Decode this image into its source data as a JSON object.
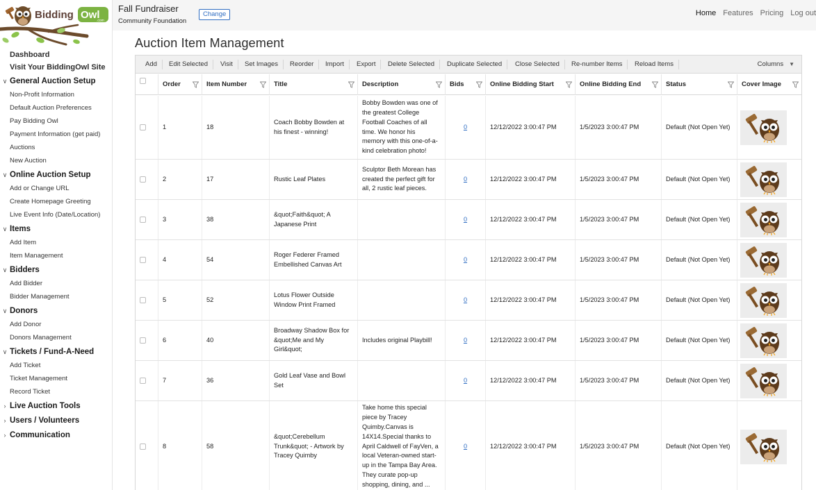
{
  "brand": {
    "logo_text_1": "Bidding",
    "logo_text_2": "Owl",
    "logo_sub": ".com"
  },
  "sidebar": {
    "top_links": [
      "Dashboard",
      "Visit Your BiddingOwl Site"
    ],
    "sections": [
      {
        "title": "General Auction Setup",
        "expanded": true,
        "items": [
          "Non-Profit Information",
          "Default Auction Preferences",
          "Pay Bidding Owl",
          "Payment Information (get paid)",
          "Auctions",
          "New Auction"
        ]
      },
      {
        "title": "Online Auction Setup",
        "expanded": true,
        "items": [
          "Add or Change URL",
          "Create Homepage Greeting",
          "Live Event Info (Date/Location)"
        ]
      },
      {
        "title": "Items",
        "expanded": true,
        "items": [
          "Add Item",
          "Item Management"
        ]
      },
      {
        "title": "Bidders",
        "expanded": true,
        "items": [
          "Add Bidder",
          "Bidder Management"
        ]
      },
      {
        "title": "Donors",
        "expanded": true,
        "items": [
          "Add Donor",
          "Donors Management"
        ]
      },
      {
        "title": "Tickets / Fund-A-Need",
        "expanded": true,
        "items": [
          "Add Ticket",
          "Ticket Management",
          "Record Ticket"
        ]
      },
      {
        "title": "Live Auction Tools",
        "expanded": false,
        "items": []
      },
      {
        "title": "Users / Volunteers",
        "expanded": false,
        "items": []
      },
      {
        "title": "Communication",
        "expanded": false,
        "items": []
      }
    ]
  },
  "header": {
    "event_title": "Fall Fundraiser",
    "event_org": "Community Foundation",
    "change_label": "Change",
    "nav": [
      "Home",
      "Features",
      "Pricing",
      "Log out"
    ],
    "active_nav": "Home"
  },
  "page_title": "Auction Item Management",
  "toolbar": {
    "buttons": [
      "Add",
      "Edit Selected",
      "Visit",
      "Set Images",
      "Reorder",
      "Import",
      "Export",
      "Delete Selected",
      "Duplicate Selected",
      "Close Selected",
      "Re-number Items",
      "Reload Items"
    ],
    "columns_label": "Columns"
  },
  "table": {
    "columns": [
      "Order",
      "Item Number",
      "Title",
      "Description",
      "Bids",
      "Online Bidding Start",
      "Online Bidding End",
      "Status",
      "Cover Image"
    ],
    "rows": [
      {
        "order": "1",
        "item_number": "18",
        "title": "Coach Bobby Bowden at his finest - winning!",
        "description": "Bobby Bowden was one of the greatest College Football Coaches of all time. We honor his memory with this one-of-a-kind celebration photo!",
        "bids": "0",
        "start": "12/12/2022 3:00:47 PM",
        "end": "1/5/2023 3:00:47 PM",
        "status": "Default (Not Open Yet)"
      },
      {
        "order": "2",
        "item_number": "17",
        "title": "Rustic Leaf Plates",
        "description": "Sculptor Beth Morean has created the perfect gift for all, 2 rustic leaf pieces.",
        "bids": "0",
        "start": "12/12/2022 3:00:47 PM",
        "end": "1/5/2023 3:00:47 PM",
        "status": "Default (Not Open Yet)"
      },
      {
        "order": "3",
        "item_number": "38",
        "title": "&quot;Faith&quot; A Japanese Print",
        "description": "",
        "bids": "0",
        "start": "12/12/2022 3:00:47 PM",
        "end": "1/5/2023 3:00:47 PM",
        "status": "Default (Not Open Yet)"
      },
      {
        "order": "4",
        "item_number": "54",
        "title": "Roger Federer Framed Embellished Canvas Art",
        "description": "",
        "bids": "0",
        "start": "12/12/2022 3:00:47 PM",
        "end": "1/5/2023 3:00:47 PM",
        "status": "Default (Not Open Yet)"
      },
      {
        "order": "5",
        "item_number": "52",
        "title": "Lotus Flower Outside Window Print Framed",
        "description": "",
        "bids": "0",
        "start": "12/12/2022 3:00:47 PM",
        "end": "1/5/2023 3:00:47 PM",
        "status": "Default (Not Open Yet)"
      },
      {
        "order": "6",
        "item_number": "40",
        "title": "Broadway Shadow Box for &quot;Me and My Girl&quot;",
        "description": "Includes original Playbill!",
        "bids": "0",
        "start": "12/12/2022 3:00:47 PM",
        "end": "1/5/2023 3:00:47 PM",
        "status": "Default (Not Open Yet)"
      },
      {
        "order": "7",
        "item_number": "36",
        "title": "Gold Leaf Vase and Bowl Set",
        "description": "",
        "bids": "0",
        "start": "12/12/2022 3:00:47 PM",
        "end": "1/5/2023 3:00:47 PM",
        "status": "Default (Not Open Yet)"
      },
      {
        "order": "8",
        "item_number": "58",
        "title": "&quot;Cerebellum Trunk&quot; - Artwork by Tracey Quimby",
        "description": "Take home this special piece by Tracey Quimby.Canvas is 14X14.Special thanks to April Caldwell of FayVen, a local Veteran-owned start-up in the Tampa Bay Area. They curate pop-up shopping, dining, and ...",
        "bids": "0",
        "start": "12/12/2022 3:00:47 PM",
        "end": "1/5/2023 3:00:47 PM",
        "status": "Default (Not Open Yet)"
      }
    ]
  },
  "colors": {
    "link_blue": "#2f6dc2",
    "brand_green": "#7cb342",
    "brand_brown": "#6d4c2a",
    "header_bg": "#f5f5f5",
    "toolbar_bg": "#f0f0f0"
  },
  "icons": {
    "cover_image": "owl-gavel-icon",
    "filter": "filter-icon",
    "section_expanded": "chevron-down-icon",
    "section_collapsed": "chevron-right-icon"
  }
}
